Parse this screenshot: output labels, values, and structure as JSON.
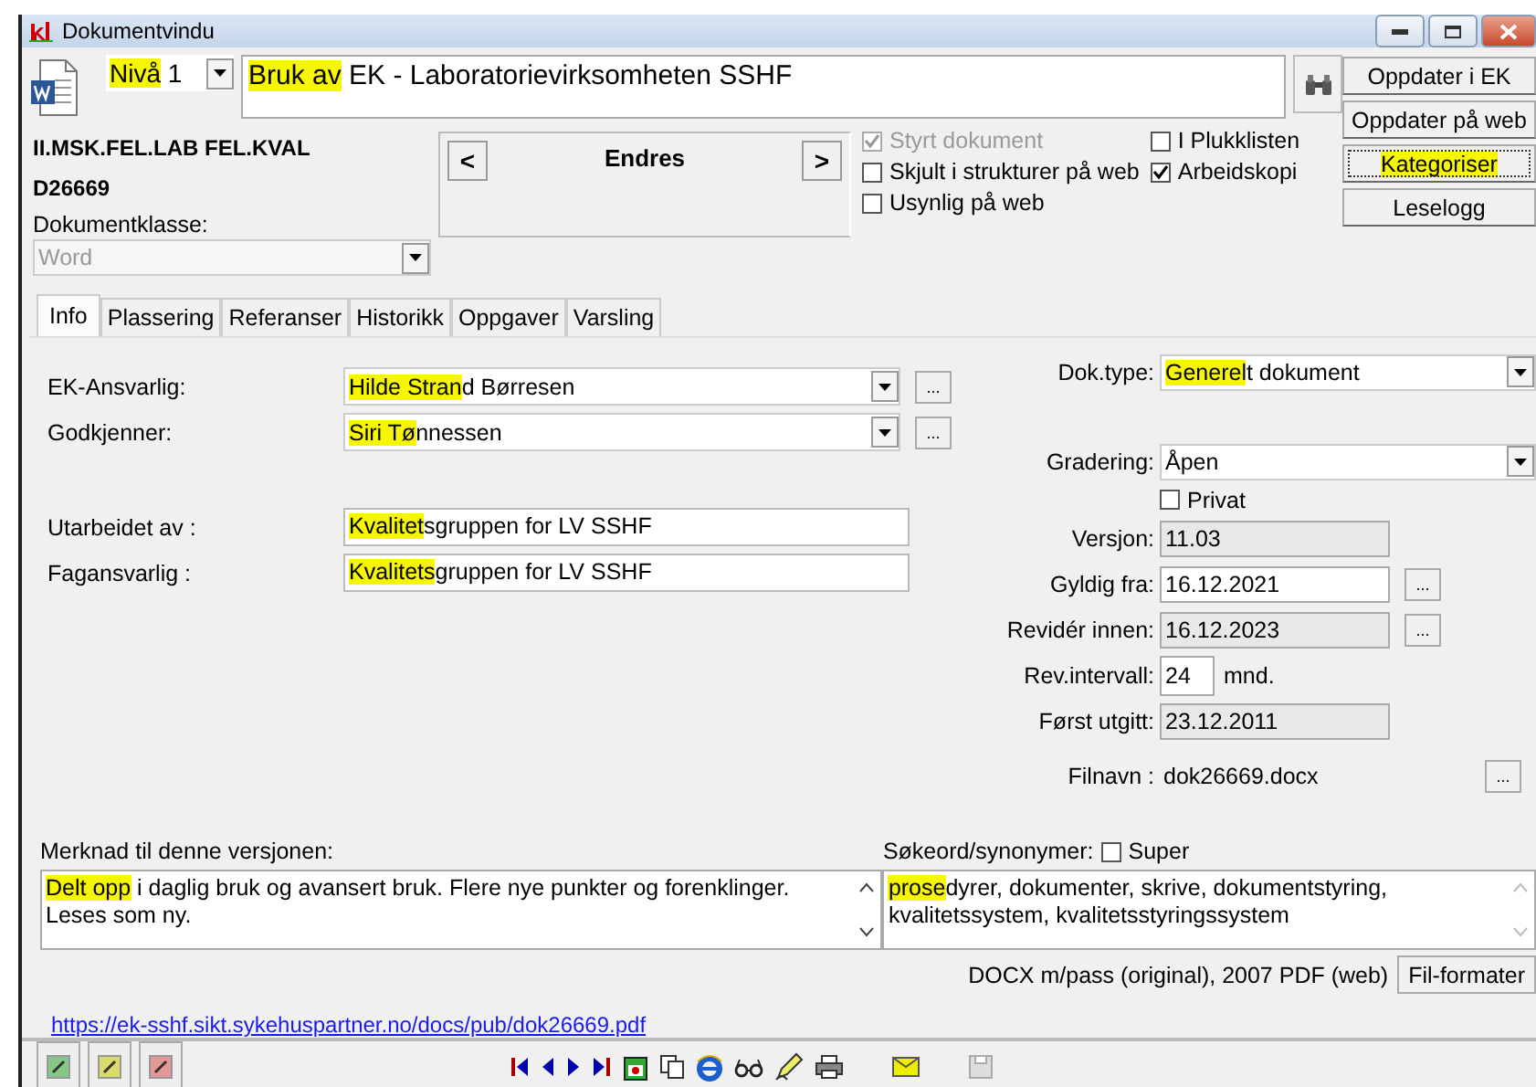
{
  "window": {
    "title": "Dokumentvindu"
  },
  "level_select": {
    "value": [
      {
        "text": "Nivå",
        "highlighted": true
      },
      {
        "text": " 1",
        "highlighted": false
      }
    ]
  },
  "document_title": {
    "value": [
      {
        "text": "Bruk av",
        "highlighted": true
      },
      {
        "text": " EK - Laboratorievirksomheten SSHF",
        "highlighted": false
      }
    ]
  },
  "side_buttons": [
    {
      "label": [
        {
          "text": "Oppdater i EK",
          "highlighted": false
        }
      ],
      "focused": false
    },
    {
      "label": [
        {
          "text": "Oppdater på web",
          "highlighted": false
        }
      ],
      "focused": false
    },
    {
      "label": [
        {
          "text": "Kategoriser",
          "highlighted": true
        }
      ],
      "focused": true
    },
    {
      "label": [
        {
          "text": "Leselogg",
          "highlighted": false
        }
      ],
      "focused": false
    }
  ],
  "document_code": "II.MSK.FEL.LAB FEL.KVAL",
  "document_id": "D26669",
  "document_class": {
    "label": "Dokumentklasse:",
    "value": "Word",
    "disabled": true
  },
  "status_panel": {
    "prev": "<",
    "status": "Endres",
    "next": ">"
  },
  "checkboxes": [
    {
      "label": "Styrt dokument",
      "checked": true,
      "disabled": true
    },
    {
      "label": "Skjult i strukturer på web",
      "checked": false,
      "disabled": false
    },
    {
      "label": "Usynlig på web",
      "checked": false,
      "disabled": false
    },
    {
      "label": "I Plukklisten",
      "checked": false,
      "disabled": false
    },
    {
      "label": "Arbeidskopi",
      "checked": true,
      "disabled": false
    }
  ],
  "tabs": [
    {
      "label": "Info",
      "selected": true
    },
    {
      "label": "Plassering",
      "selected": false
    },
    {
      "label": "Referanser",
      "selected": false
    },
    {
      "label": "Historikk",
      "selected": false
    },
    {
      "label": "Oppgaver",
      "selected": false
    },
    {
      "label": "Varsling",
      "selected": false
    }
  ],
  "left_fields": [
    {
      "kind": "dropdown",
      "label": "EK-Ansvarlig:",
      "value": [
        {
          "text": "Hilde Stran",
          "highlighted": true
        },
        {
          "text": "d Børresen",
          "highlighted": false
        }
      ],
      "button": "..."
    },
    {
      "kind": "dropdown",
      "label": "Godkjenner:",
      "value": [
        {
          "text": "Siri Tø",
          "highlighted": true
        },
        {
          "text": "nnessen",
          "highlighted": false
        }
      ],
      "button": "..."
    },
    {
      "kind": "text",
      "label": "Utarbeidet av :",
      "value": [
        {
          "text": "Kvalitet",
          "highlighted": true
        },
        {
          "text": "sgruppen for LV SSHF",
          "highlighted": false
        }
      ]
    },
    {
      "kind": "text",
      "label": "Fagansvarlig :",
      "value": [
        {
          "text": "Kvalitets",
          "highlighted": true
        },
        {
          "text": "gruppen for LV SSHF",
          "highlighted": false
        }
      ]
    }
  ],
  "right_fields": [
    {
      "kind": "dropdown",
      "label": "Dok.type:",
      "value": [
        {
          "text": "Generel",
          "highlighted": true
        },
        {
          "text": "t dokument",
          "highlighted": false
        }
      ]
    },
    {
      "kind": "dropdown",
      "label": "Gradering:",
      "value": [
        {
          "text": "Åpen",
          "highlighted": false
        }
      ]
    },
    {
      "kind": "checkbox",
      "label": "Privat",
      "checked": false
    },
    {
      "kind": "readonly",
      "label": "Versjon:",
      "value": [
        {
          "text": "11.03",
          "highlighted": false
        }
      ]
    },
    {
      "kind": "date",
      "label": "Gyldig fra:",
      "value": [
        {
          "text": "16.12.2021",
          "highlighted": false
        }
      ],
      "button": "..."
    },
    {
      "kind": "readonly",
      "label": "Revidér innen:",
      "value": [
        {
          "text": "16.12.2023",
          "highlighted": false
        }
      ],
      "button": "..."
    },
    {
      "kind": "interval",
      "label": "Rev.intervall:",
      "value": [
        {
          "text": "24",
          "highlighted": false
        }
      ],
      "unit": "mnd."
    },
    {
      "kind": "readonly",
      "label": "Først utgitt:",
      "value": [
        {
          "text": "23.12.2011",
          "highlighted": false
        }
      ]
    },
    {
      "kind": "plain",
      "label": "Filnavn :",
      "value": [
        {
          "text": "dok26669.docx",
          "highlighted": false
        }
      ],
      "button": "..."
    }
  ],
  "note": {
    "label": "Merknad til denne versjonen:",
    "value": [
      {
        "text": "Delt opp",
        "highlighted": true
      },
      {
        "text": " i daglig bruk og avansert bruk. Flere nye punkter og forenklinger. Leses som ny.",
        "highlighted": false
      }
    ]
  },
  "keywords": {
    "label": "Søkeord/synonymer:",
    "super": {
      "label": "Super",
      "checked": false
    },
    "value": [
      {
        "text": "prose",
        "highlighted": true
      },
      {
        "text": "dyrer, dokumenter, skrive, dokumentstyring, kvalitetssystem, kvalitetsstyringssystem",
        "highlighted": false
      }
    ]
  },
  "formats": {
    "text": "DOCX m/pass (original), 2007 PDF (web)",
    "button": "Fil-formater"
  },
  "link": "https://ek-sshf.sikt.sykehuspartner.no/docs/pub/dok26669.pdf"
}
